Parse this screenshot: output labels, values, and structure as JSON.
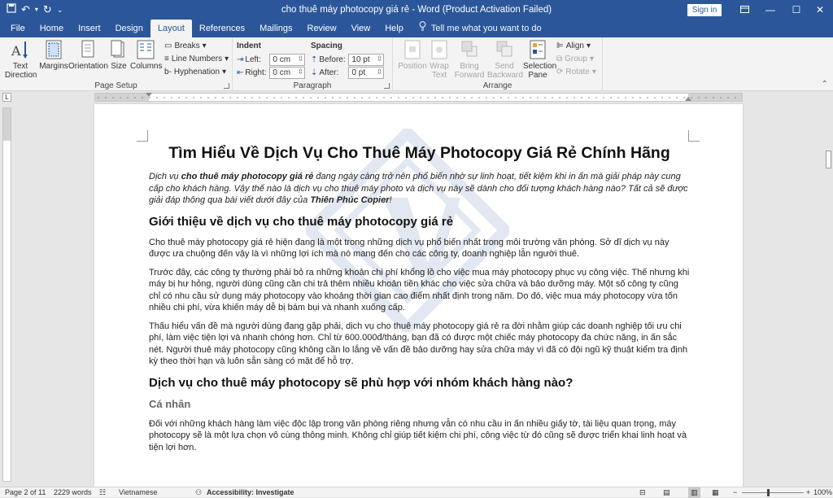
{
  "titlebar": {
    "title": "cho thuê máy photocopy giá rẻ  -  Word (Product Activation Failed)",
    "sign_in": "Sign in"
  },
  "tabs": [
    "File",
    "Home",
    "Insert",
    "Design",
    "Layout",
    "References",
    "Mailings",
    "Review",
    "View",
    "Help"
  ],
  "active_tab": "Layout",
  "tell_me": "Tell me what you want to do",
  "ribbon": {
    "page_setup": {
      "label": "Page Setup",
      "text_direction": "Text Direction",
      "margins": "Margins",
      "orientation": "Orientation",
      "size": "Size",
      "columns": "Columns",
      "breaks": "Breaks",
      "line_numbers": "Line Numbers",
      "hyphenation": "Hyphenation"
    },
    "paragraph": {
      "label": "Paragraph",
      "indent": "Indent",
      "spacing": "Spacing",
      "left_label": "Left:",
      "left_value": "0 cm",
      "right_label": "Right:",
      "right_value": "0 cm",
      "before_label": "Before:",
      "before_value": "10 pt",
      "after_label": "After:",
      "after_value": "0 pt"
    },
    "arrange": {
      "label": "Arrange",
      "position": "Position",
      "wrap_text": "Wrap Text",
      "bring_forward": "Bring Forward",
      "send_backward": "Send Backward",
      "selection_pane": "Selection Pane",
      "align": "Align",
      "group": "Group",
      "rotate": "Rotate"
    }
  },
  "document": {
    "title": "Tìm Hiểu Về Dịch Vụ Cho Thuê Máy Photocopy Giá Rẻ Chính Hãng",
    "intro": {
      "p1": "Dịch vụ ",
      "b1": "cho thuê máy photocopy giá rẻ",
      "p2": " đang ngày càng trở nên phổ biến nhờ sự linh hoạt, tiết kiệm khi in ấn mà giải pháp này cung cấp cho khách hàng. Vậy thế nào là dịch vụ cho thuê máy photo và dịch vụ này sẽ dành cho đối tượng khách hàng nào? Tất cả sẽ được giải đáp thông qua bài viết dưới đây của ",
      "b2": "Thiên Phúc Copier",
      "p3": "!"
    },
    "h2_1": "Giới thiệu về dịch vụ cho thuê máy photocopy giá rẻ",
    "para1": "Cho thuê máy photocopy giá rẻ hiện đang là một trong những dịch vụ phổ biến nhất trong môi trường văn phòng. Sở dĩ dịch vụ này được ưa chuộng đến vậy là vì những lợi ích mà nó mang đến cho các công ty, doanh nghiệp lẫn người thuê.",
    "para2": "Trước đây, các công ty thường phải bỏ ra những khoản chi phí khổng lồ cho việc mua máy photocopy phục vụ công việc. Thế nhưng khi máy bị hư hỏng, người dùng cũng cần chi trả thêm nhiều khoản tiền khác cho việc sửa chữa và bảo dưỡng máy. Một số công ty cũng chỉ có nhu cầu sử dụng máy photocopy vào khoảng thời gian cao điểm nhất định trong năm. Do đó, việc mua máy photocopy vừa tốn nhiều chi phí, vừa khiến máy dễ bị bám bụi và nhanh xuống cấp.",
    "para3": "Thấu hiểu vấn đề mà người dùng đang gặp phải, dịch vụ cho thuê máy photocopy giá rẻ ra đời nhằm giúp các doanh nghiệp tối ưu chi phí, làm việc tiện lợi và nhanh chóng hơn. Chỉ từ 600.000đ/tháng, bạn đã có được một chiếc máy photocopy đa chức năng, in ấn sắc nét. Người thuê máy photocopy cũng không cần lo lắng về vấn đề bảo dưỡng hay sửa chữa máy vì đã có đội ngũ kỹ thuật kiểm tra định kỳ theo thời hạn và luôn sẵn sàng có mặt để hỗ trợ.",
    "h2_2": "Dịch vụ cho thuê máy photocopy sẽ phù hợp với nhóm khách hàng nào?",
    "h3_1": "Cá nhân",
    "para4": "Đối với những khách hàng làm việc độc lập trong văn phòng riêng nhưng vẫn có nhu cầu in ấn nhiều giấy tờ, tài liệu quan trọng, máy photocopy sẽ là một lựa chọn vô cùng thông minh. Không chỉ giúp tiết kiệm chi phí, công việc từ đó cũng sẽ được triển khai linh hoạt và tiện lợi hơn."
  },
  "statusbar": {
    "page": "Page 2 of 11",
    "words": "2229 words",
    "language": "Vietnamese",
    "accessibility": "Accessibility: Investigate",
    "zoom": "100%",
    "zoom_fraction": 0.42
  },
  "colors": {
    "word_blue": "#2b579a",
    "ribbon_bg": "#f3f3f3",
    "canvas_bg": "#e6e6e6"
  }
}
